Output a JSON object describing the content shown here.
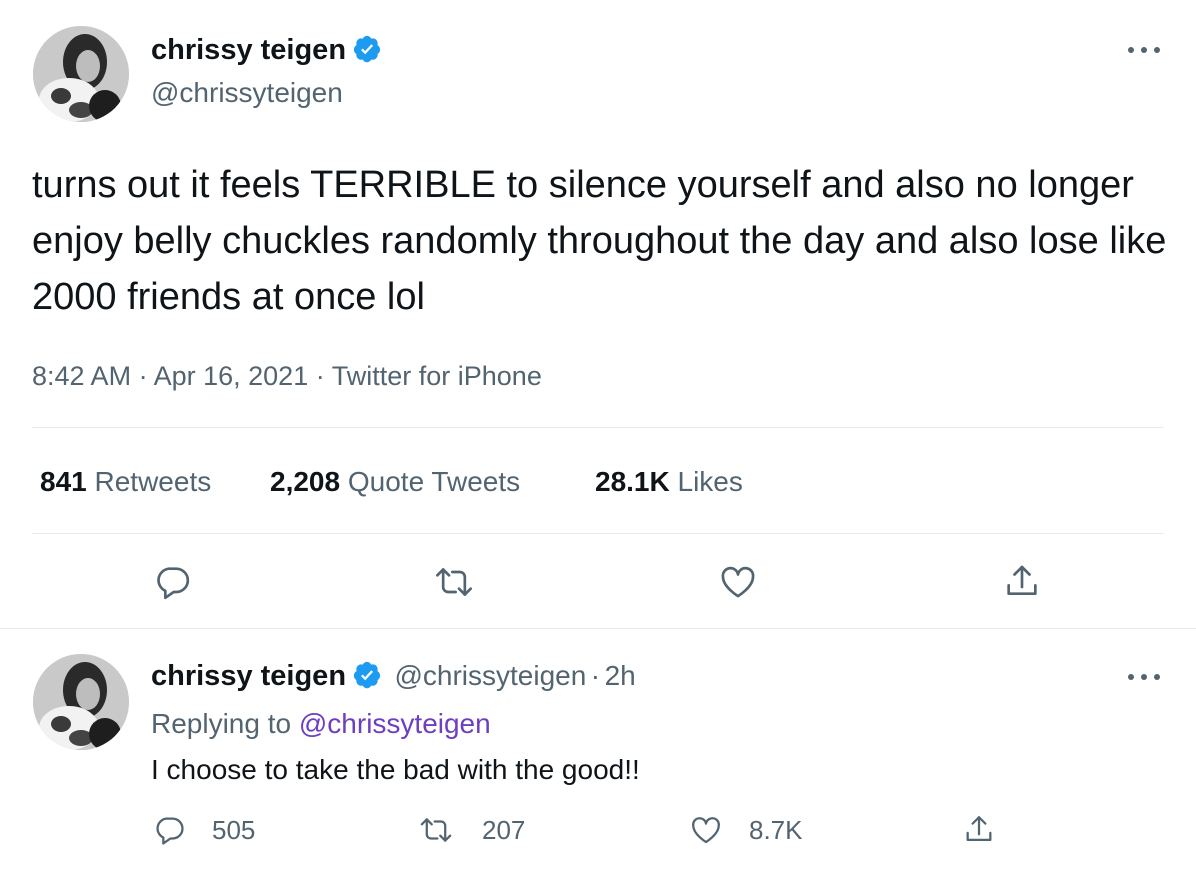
{
  "main_tweet": {
    "author": {
      "name": "chrissy teigen",
      "handle": "@chrissyteigen",
      "verified": true
    },
    "text": "turns out it feels TERRIBLE to silence yourself and also no longer enjoy belly chuckles randomly throughout the day and also lose like 2000 friends at once lol",
    "meta": {
      "time": "8:42 AM",
      "separator": "·",
      "date": "Apr 16, 2021",
      "source": "Twitter for iPhone"
    },
    "stats": {
      "retweets_count": "841",
      "retweets_label": "Retweets",
      "quotes_count": "2,208",
      "quotes_label": "Quote Tweets",
      "likes_count": "28.1K",
      "likes_label": "Likes"
    },
    "actions": [
      "reply-icon",
      "retweet-icon",
      "like-icon",
      "share-icon"
    ]
  },
  "reply_tweet": {
    "author": {
      "name": "chrissy teigen",
      "handle": "@chrissyteigen",
      "verified": true
    },
    "dot": "·",
    "time_ago": "2h",
    "replying_prefix": "Replying to",
    "replying_to": "@chrissyteigen",
    "text": "I choose to take the bad with the good!!",
    "counts": {
      "replies": "505",
      "retweets": "207",
      "likes": "8.7K"
    }
  },
  "colors": {
    "text_primary": "#0f1419",
    "text_secondary": "#536471",
    "verified_blue": "#1d9bf0",
    "link_purple": "#6d3fc0",
    "divider": "#e6ebee"
  }
}
